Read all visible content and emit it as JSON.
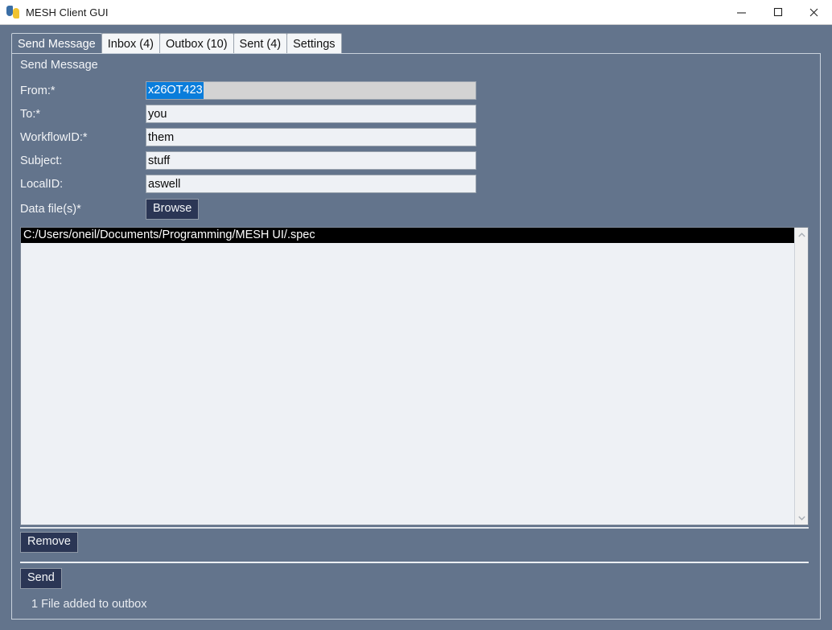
{
  "window": {
    "title": "MESH Client GUI",
    "icon": "python-logo-icon",
    "minimize_label": "—",
    "maximize_label": "□",
    "close_label": "✕",
    "background_color": "#63748c"
  },
  "tabs": [
    {
      "label": "Send Message",
      "active": true,
      "name": "tab-send-message"
    },
    {
      "label": "Inbox (4)",
      "active": false,
      "name": "tab-inbox"
    },
    {
      "label": "Outbox (10)",
      "active": false,
      "name": "tab-outbox"
    },
    {
      "label": "Sent (4)",
      "active": false,
      "name": "tab-sent"
    },
    {
      "label": "Settings",
      "active": false,
      "name": "tab-settings"
    }
  ],
  "send_message": {
    "section_title": "Send Message",
    "fields": {
      "from": {
        "label": "From:*",
        "value": "x26OT423",
        "placeholder": "",
        "readonly": true,
        "selected": true,
        "selection_color": "#0a7ddb",
        "background_color": "#d3d3d3"
      },
      "to": {
        "label": "To:*",
        "value": "you",
        "placeholder": ""
      },
      "workflow_id": {
        "label": "WorkflowID:*",
        "value": "them",
        "placeholder": ""
      },
      "subject": {
        "label": "Subject:",
        "value": "stuff",
        "placeholder": ""
      },
      "local_id": {
        "label": "LocalID:",
        "value": "aswell",
        "placeholder": ""
      },
      "data_files": {
        "label": "Data file(s)*",
        "browse_label": "Browse"
      }
    },
    "file_list": {
      "items": [
        {
          "path": "C:/Users/oneil/Documents/Programming/MESH UI/.spec",
          "selected": true
        }
      ],
      "scroll_up_icon": "chevron-up-icon",
      "scroll_down_icon": "chevron-down-icon"
    },
    "remove_label": "Remove",
    "send_label": "Send",
    "status_text": "1 File added to outbox",
    "button_color": "#2b3655"
  }
}
